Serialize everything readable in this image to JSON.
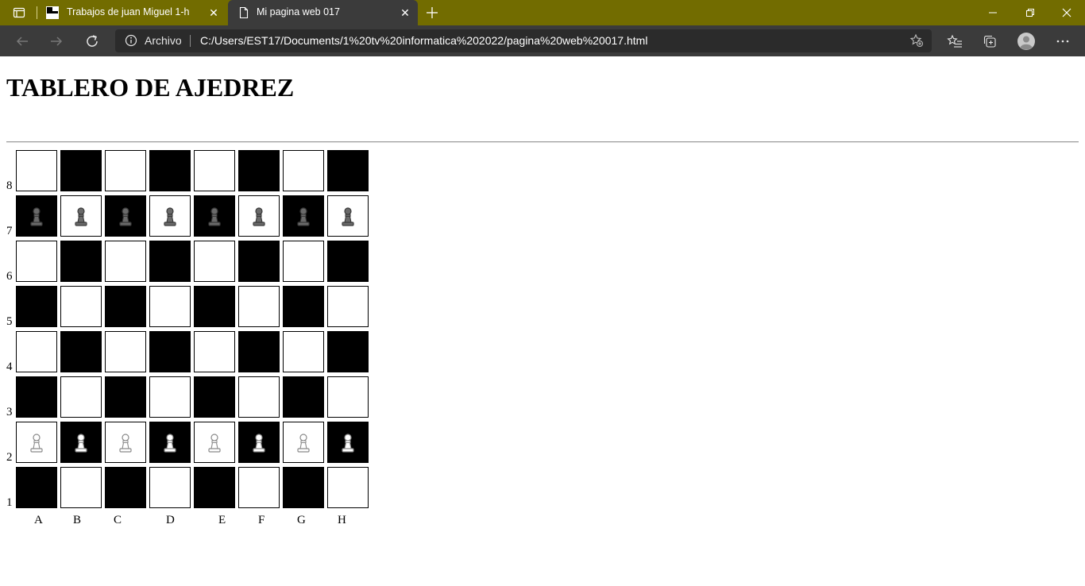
{
  "browser": {
    "tabs": [
      {
        "label": "Trabajos de juan Miguel 1-h",
        "active": false
      },
      {
        "label": "Mi pagina web 017",
        "active": true
      }
    ],
    "address": {
      "label": "Archivo",
      "url": "C:/Users/EST17/Documents/1%20tv%20informatica%202022/pagina%20web%20017.html"
    }
  },
  "page": {
    "title": "TABLERO DE AJEDREZ",
    "ranks": [
      "8",
      "7",
      "6",
      "5",
      "4",
      "3",
      "2",
      "1"
    ],
    "files": [
      "A",
      "B",
      "C",
      "D",
      "E",
      "F",
      "G",
      "H"
    ],
    "board": {
      "pieces": {
        "7": [
          "black-pawn",
          "black-pawn",
          "black-pawn",
          "black-pawn",
          "black-pawn",
          "black-pawn",
          "black-pawn",
          "black-pawn"
        ],
        "2": [
          "white-pawn",
          "white-pawn",
          "white-pawn",
          "white-pawn",
          "white-pawn",
          "white-pawn",
          "white-pawn",
          "white-pawn"
        ]
      }
    }
  },
  "colors": {
    "titlebar": "#726c00",
    "toolbar": "#3b3b3b",
    "dark_square": "#000000",
    "light_square": "#ffffff"
  }
}
